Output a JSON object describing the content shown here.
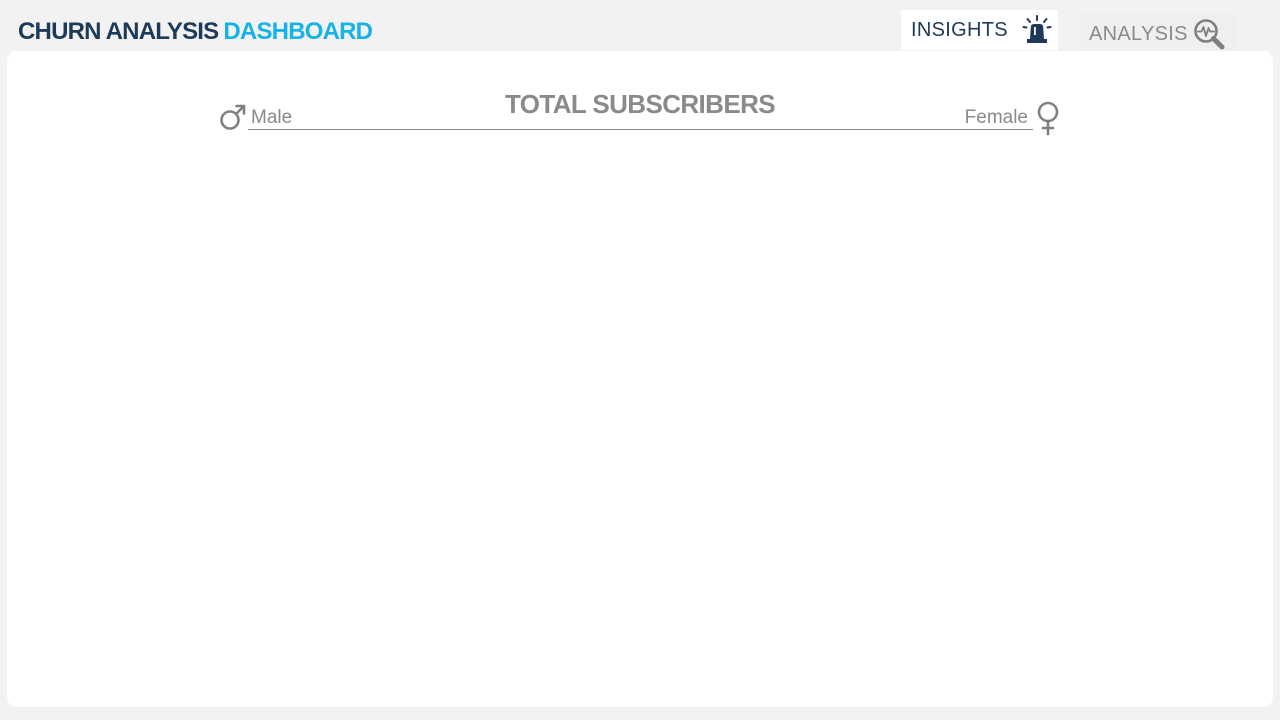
{
  "header": {
    "title_part1": "CHURN ANALYSIS",
    "title_part2": "DASHBOARD",
    "title_colors": {
      "primary": "#1e3a5a",
      "accent": "#17b3e6"
    }
  },
  "nav": {
    "tabs": [
      {
        "label": "INSIGHTS",
        "icon": "siren-alert-icon",
        "active": true
      },
      {
        "label": "ANALYSIS",
        "icon": "magnifier-pulse-icon",
        "active": false
      }
    ]
  },
  "main": {
    "subscribers": {
      "title": "TOTAL SUBSCRIBERS",
      "male_label": "Male",
      "female_label": "Female",
      "male_icon": "male-symbol-icon",
      "female_icon": "female-symbol-icon"
    }
  },
  "colors": {
    "background": "#f2f2f2",
    "panel": "#ffffff",
    "muted_text": "#8a8a8a"
  }
}
